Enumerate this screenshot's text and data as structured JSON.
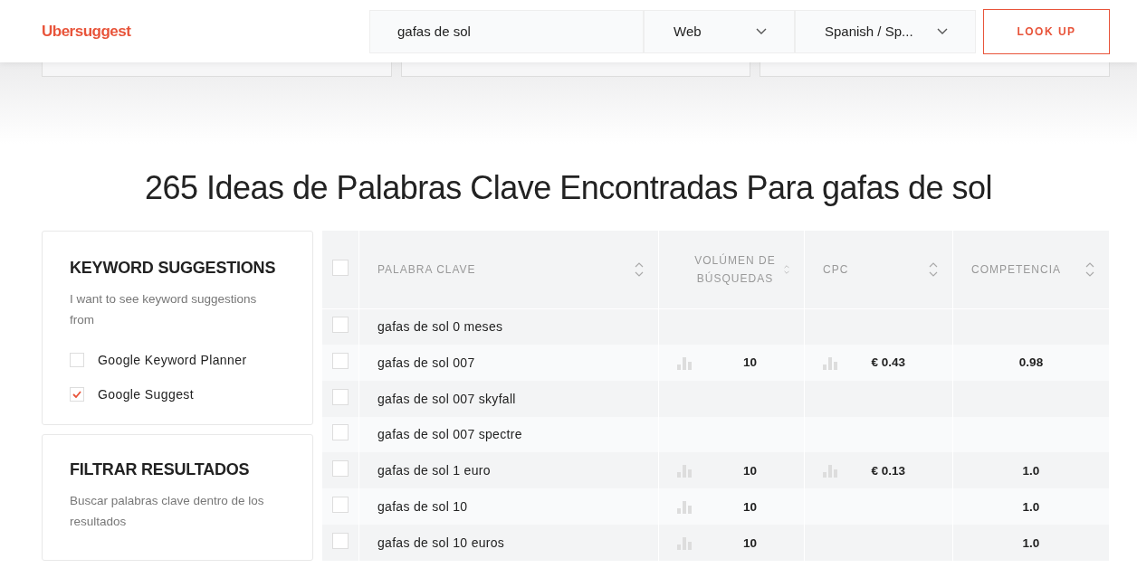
{
  "header": {
    "logo": "Ubersuggest",
    "search_value": "gafas de sol",
    "source": "Web",
    "language": "Spanish / Sp...",
    "button": "LOOK UP"
  },
  "heading": "265 Ideas de Palabras Clave Encontradas Para gafas de sol",
  "sidebar": {
    "suggestions": {
      "title": "KEYWORD SUGGESTIONS",
      "description": "I want to see keyword suggestions from",
      "options": [
        {
          "label": "Google Keyword Planner",
          "checked": false
        },
        {
          "label": "Google Suggest",
          "checked": true
        }
      ]
    },
    "filter": {
      "title": "FILTRAR RESULTADOS",
      "description": "Buscar palabras clave dentro de los resultados"
    }
  },
  "table": {
    "select_all": {
      "checked": false
    },
    "columns": [
      "PALABRA CLAVE",
      "VOLÚMEN DE BÚSQUEDAS",
      "CPC",
      "COMPETENCIA"
    ],
    "rows": [
      {
        "checked": false,
        "keyword": "gafas de sol 0 meses"
      },
      {
        "checked": false,
        "keyword": "gafas de sol 007",
        "volume": "10",
        "cpc": "€ 0.43",
        "competition": "0.98"
      },
      {
        "checked": false,
        "keyword": "gafas de sol 007 skyfall"
      },
      {
        "checked": false,
        "keyword": "gafas de sol 007 spectre"
      },
      {
        "checked": false,
        "keyword": "gafas de sol 1 euro",
        "volume": "10",
        "cpc": "€ 0.13",
        "competition": "1.0"
      },
      {
        "checked": false,
        "keyword": "gafas de sol 10",
        "volume": "10",
        "competition": "1.0"
      },
      {
        "checked": false,
        "keyword": "gafas de sol 10 euros",
        "volume": "10",
        "competition": "1.0"
      }
    ]
  }
}
